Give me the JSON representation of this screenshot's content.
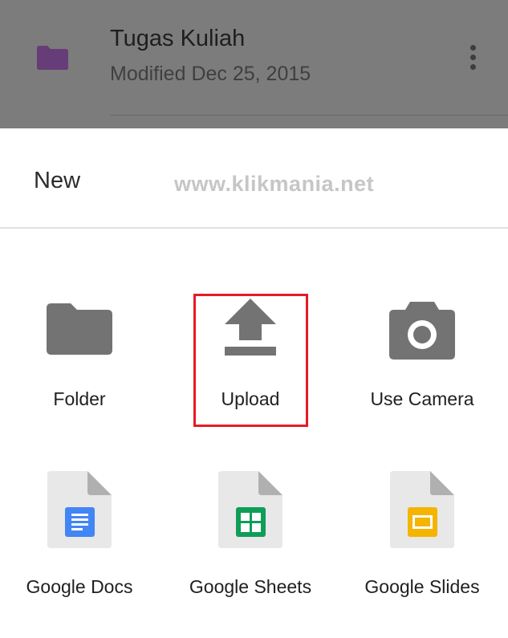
{
  "background_file": {
    "name": "Tugas Kuliah",
    "modified": "Modified Dec 25, 2015",
    "icon": "folder-icon",
    "folder_color": "#663d78"
  },
  "sheet": {
    "title": "New",
    "watermark": "www.klikmania.net"
  },
  "actions": [
    {
      "label": "Folder",
      "icon": "folder-icon"
    },
    {
      "label": "Upload",
      "icon": "upload-icon"
    },
    {
      "label": "Use Camera",
      "icon": "camera-icon"
    },
    {
      "label": "Google Docs",
      "icon": "google-docs-icon",
      "color": "#4285f4"
    },
    {
      "label": "Google Sheets",
      "icon": "google-sheets-icon",
      "color": "#0f9d58"
    },
    {
      "label": "Google Slides",
      "icon": "google-slides-icon",
      "color": "#f4b400"
    }
  ],
  "highlight_color": "#e51b24"
}
